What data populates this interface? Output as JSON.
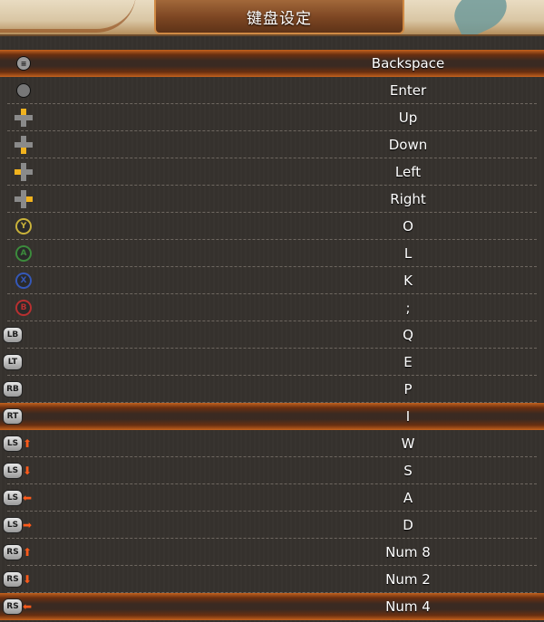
{
  "header": {
    "title": "键盘设定"
  },
  "rows": [
    {
      "icon": "back-button-icon",
      "key": "Backspace"
    },
    {
      "icon": "start-button-icon",
      "key": "Enter"
    },
    {
      "icon": "dpad-up-icon",
      "key": "Up"
    },
    {
      "icon": "dpad-down-icon",
      "key": "Down"
    },
    {
      "icon": "dpad-left-icon",
      "key": "Left"
    },
    {
      "icon": "dpad-right-icon",
      "key": "Right"
    },
    {
      "icon": "y-button-icon",
      "label": "Y",
      "key": "O"
    },
    {
      "icon": "a-button-icon",
      "label": "A",
      "key": "L"
    },
    {
      "icon": "x-button-icon",
      "label": "X",
      "key": "K"
    },
    {
      "icon": "b-button-icon",
      "label": "B",
      "key": ";"
    },
    {
      "icon": "lb-button-icon",
      "label": "LB",
      "key": "Q"
    },
    {
      "icon": "lt-button-icon",
      "label": "LT",
      "key": "E"
    },
    {
      "icon": "rb-button-icon",
      "label": "RB",
      "key": "P"
    },
    {
      "icon": "rt-button-icon",
      "label": "RT",
      "key": "I"
    },
    {
      "icon": "ls-up-icon",
      "label": "LS",
      "key": "W"
    },
    {
      "icon": "ls-down-icon",
      "label": "LS",
      "key": "S"
    },
    {
      "icon": "ls-left-icon",
      "label": "LS",
      "key": "A"
    },
    {
      "icon": "ls-right-icon",
      "label": "LS",
      "key": "D"
    },
    {
      "icon": "rs-up-icon",
      "label": "RS",
      "key": "Num 8"
    },
    {
      "icon": "rs-down-icon",
      "label": "RS",
      "key": "Num 2"
    },
    {
      "icon": "rs-left-icon",
      "label": "RS",
      "key": "Num 4"
    }
  ],
  "colors": {
    "accent": "#c4621e",
    "y": "#c9b23a",
    "a": "#3c8b3c",
    "x": "#3558b8",
    "b": "#b83030",
    "dpad_active": "#f0b21e",
    "stick_arrow": "#ff5a1a"
  }
}
